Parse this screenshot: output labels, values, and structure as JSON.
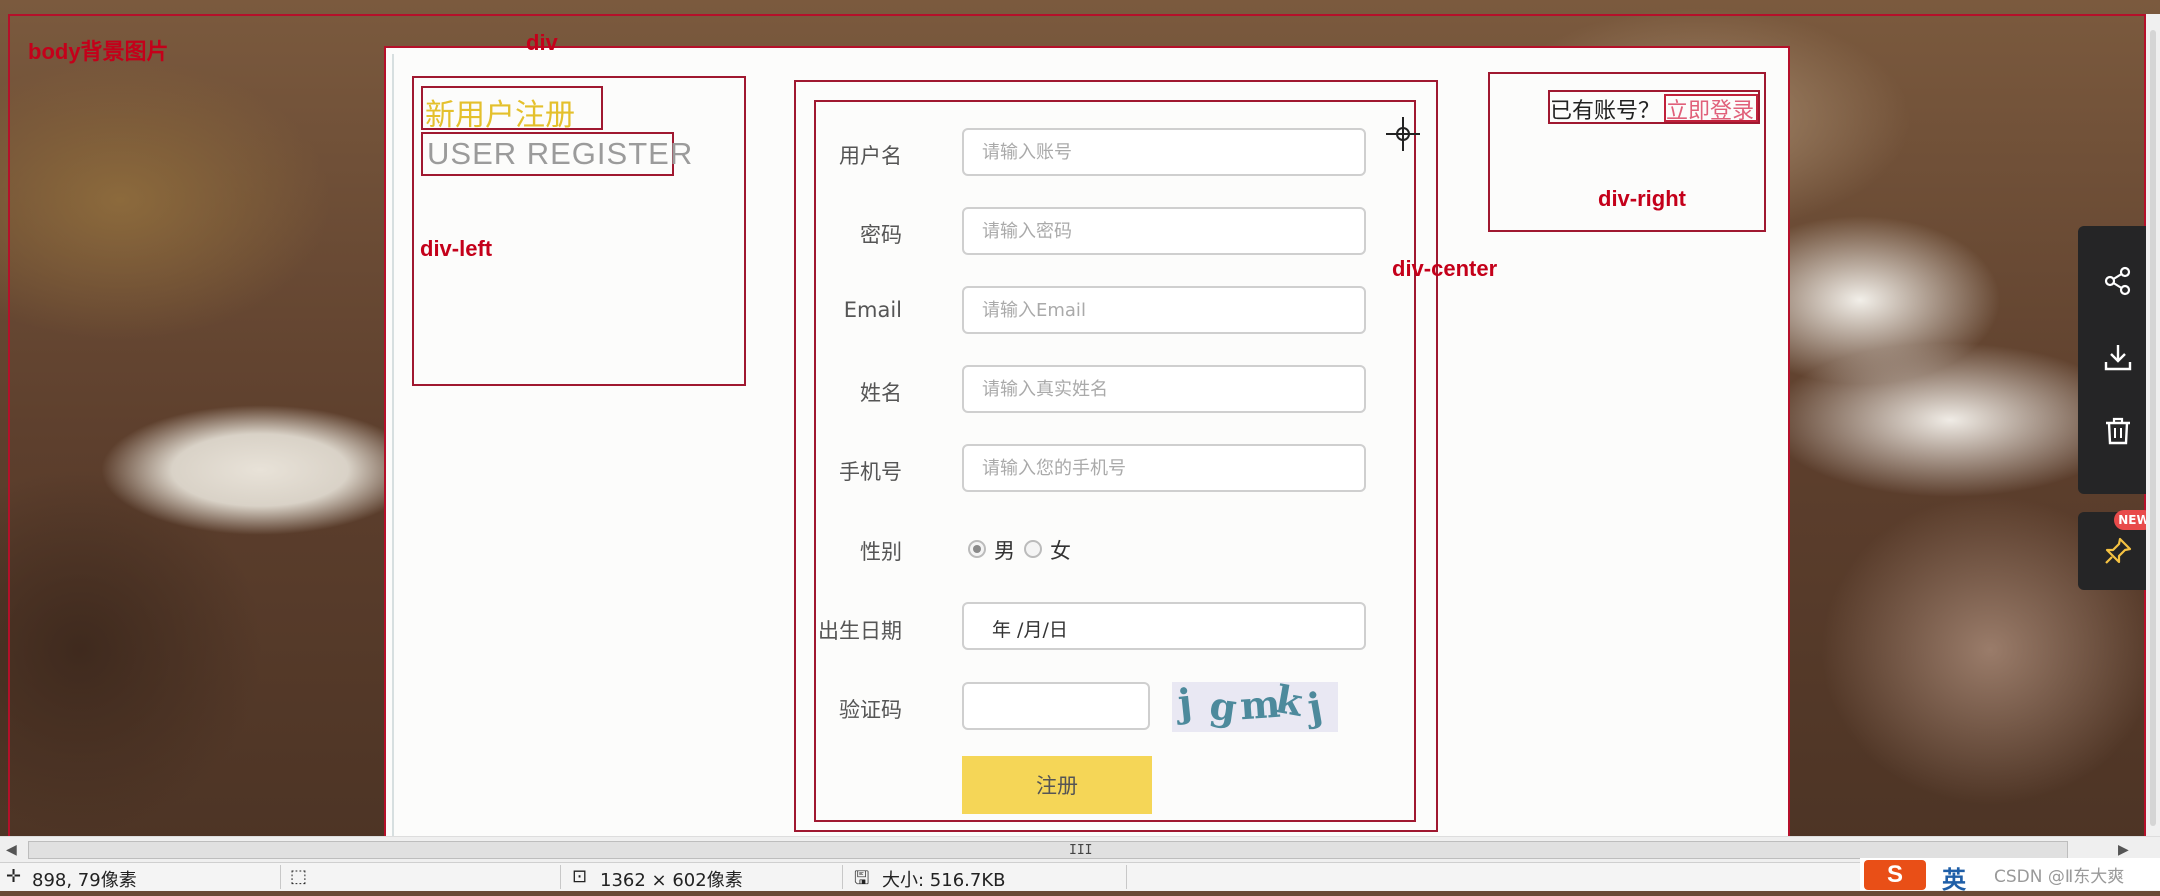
{
  "annotations": {
    "body_bg": "body背景图片",
    "div": "div",
    "div_left": "div-left",
    "div_center": "div-center",
    "div_right": "div-right"
  },
  "left": {
    "title_cn": "新用户注册",
    "title_en": "USER REGISTER"
  },
  "form": {
    "username": {
      "label": "用户名",
      "placeholder": "请输入账号",
      "value": ""
    },
    "password": {
      "label": "密码",
      "placeholder": "请输入密码",
      "value": ""
    },
    "email": {
      "label": "Email",
      "placeholder": "请输入Email",
      "value": ""
    },
    "realname": {
      "label": "姓名",
      "placeholder": "请输入真实姓名",
      "value": ""
    },
    "phone": {
      "label": "手机号",
      "placeholder": "请输入您的手机号",
      "value": ""
    },
    "gender": {
      "label": "性别",
      "options": [
        "男",
        "女"
      ],
      "selected": "男"
    },
    "birthday": {
      "label": "出生日期",
      "display": "年 /月/日"
    },
    "captcha": {
      "label": "验证码",
      "value": "",
      "image_text": [
        "j",
        "g",
        "m",
        "k",
        "j"
      ]
    },
    "submit_label": "注册"
  },
  "right": {
    "has_account": "已有账号？",
    "login_link": "立即登录"
  },
  "statusbar": {
    "cursor_pos": "898, 79像素",
    "image_size": "1362 × 602像素",
    "file_size": "大小: 516.7KB"
  },
  "scrollbar": {
    "grip": "III"
  },
  "toolbox": {
    "icons": [
      "share-icon",
      "download-icon",
      "trash-icon",
      "pin-icon"
    ],
    "badge": "NEW"
  },
  "ime": {
    "logo": "S",
    "lang": "英"
  },
  "watermark": "CSDN @Ⅱ东大爽",
  "colors": {
    "annotation_red": "#c4001a",
    "title_yellow": "#e4c02c",
    "submit_yellow": "#f5d657",
    "link_pink": "#e0607a"
  }
}
